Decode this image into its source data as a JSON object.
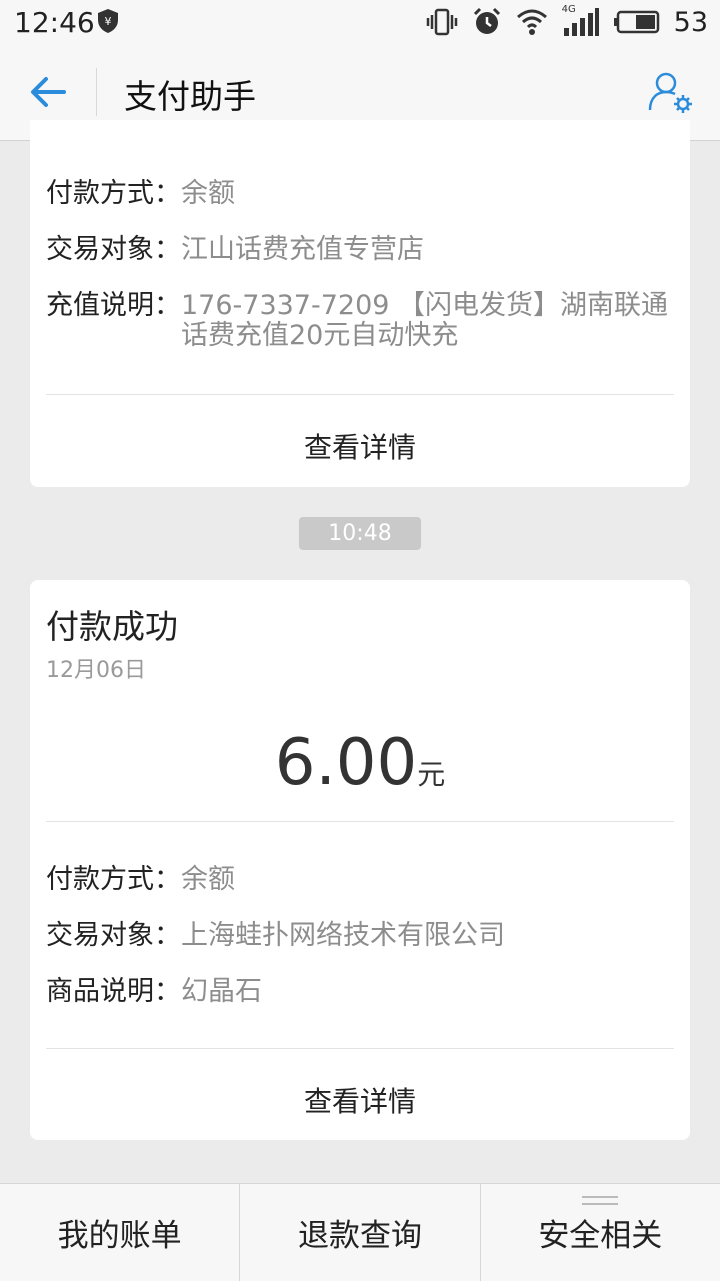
{
  "status": {
    "time": "12:46",
    "battery": "53",
    "net_label": "4G"
  },
  "header": {
    "title": "支付助手"
  },
  "card1": {
    "rows": [
      {
        "key": "付款方式：",
        "value": "余额"
      },
      {
        "key": "交易对象：",
        "value": "江山话费充值专营店"
      },
      {
        "key": "充值说明：",
        "value": "176-7337-7209 【闪电发货】湖南联通\n话费充值20元自动快充"
      }
    ],
    "detail_label": "查看详情"
  },
  "time_divider": "10:48",
  "card2": {
    "title": "付款成功",
    "date": "12月06日",
    "amount": "6.00",
    "unit": "元",
    "rows": [
      {
        "key": "付款方式：",
        "value": "余额"
      },
      {
        "key": "交易对象：",
        "value": "上海蛙扑网络技术有限公司"
      },
      {
        "key": "商品说明：",
        "value": "幻晶石"
      }
    ],
    "detail_label": "查看详情"
  },
  "bottom_nav": [
    {
      "label": "我的账单"
    },
    {
      "label": "退款查询"
    },
    {
      "label": "安全相关"
    }
  ],
  "colors": {
    "accent": "#2a8cdb",
    "muted_text": "#8d8d8d",
    "background": "#ebebeb"
  }
}
